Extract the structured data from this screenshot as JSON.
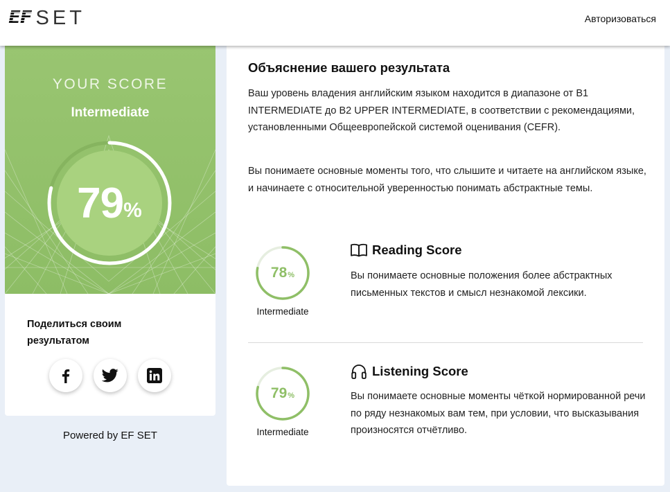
{
  "header": {
    "logo_ef": "EF",
    "logo_set": "SET",
    "login_label": "Авторизоваться"
  },
  "score_card": {
    "heading": "YOUR SCORE",
    "level": "Intermediate",
    "percent": 79,
    "percent_value": "79",
    "percent_symbol": "%",
    "share_title": "Поделиться своим результатом",
    "social": [
      {
        "icon": "facebook-icon"
      },
      {
        "icon": "twitter-icon"
      },
      {
        "icon": "linkedin-icon"
      }
    ],
    "powered_by": "Powered by EF SET"
  },
  "explanation": {
    "title": "Объяснение вашего результата",
    "paragraph_1": "Ваш уровень владения английским языком находится в диапазоне от B1 INTERMEDIATE до B2 UPPER INTERMEDIATE, в соответствии с рекомендациями, установленными Общеевропейской системой оценивания (CEFR).",
    "paragraph_2": "Вы понимаете основные моменты того, что слышите и читаете на английском языке, и начинаете с относительной уверенностью понимать абстрактные темы.",
    "reading": {
      "title": "Reading Score",
      "icon": "book-icon",
      "percent": 78,
      "percent_value": "78",
      "percent_symbol": "%",
      "level": "Intermediate",
      "description": "Вы понимаете основные положения более абстрактных письменных текстов и смысл незнакомой лексики."
    },
    "listening": {
      "title": "Listening Score",
      "icon": "headphones-icon",
      "percent": 79,
      "percent_value": "79",
      "percent_symbol": "%",
      "level": "Intermediate",
      "description": "Вы понимаете основные моменты чёткой нормированной речи по ряду незнакомых вам тем, при условии, что высказывания произносятся отчётливо."
    }
  },
  "colors": {
    "accent_green": "#8fbf67",
    "hero_green": "#99c571",
    "page_bg": "#e9eff7"
  }
}
